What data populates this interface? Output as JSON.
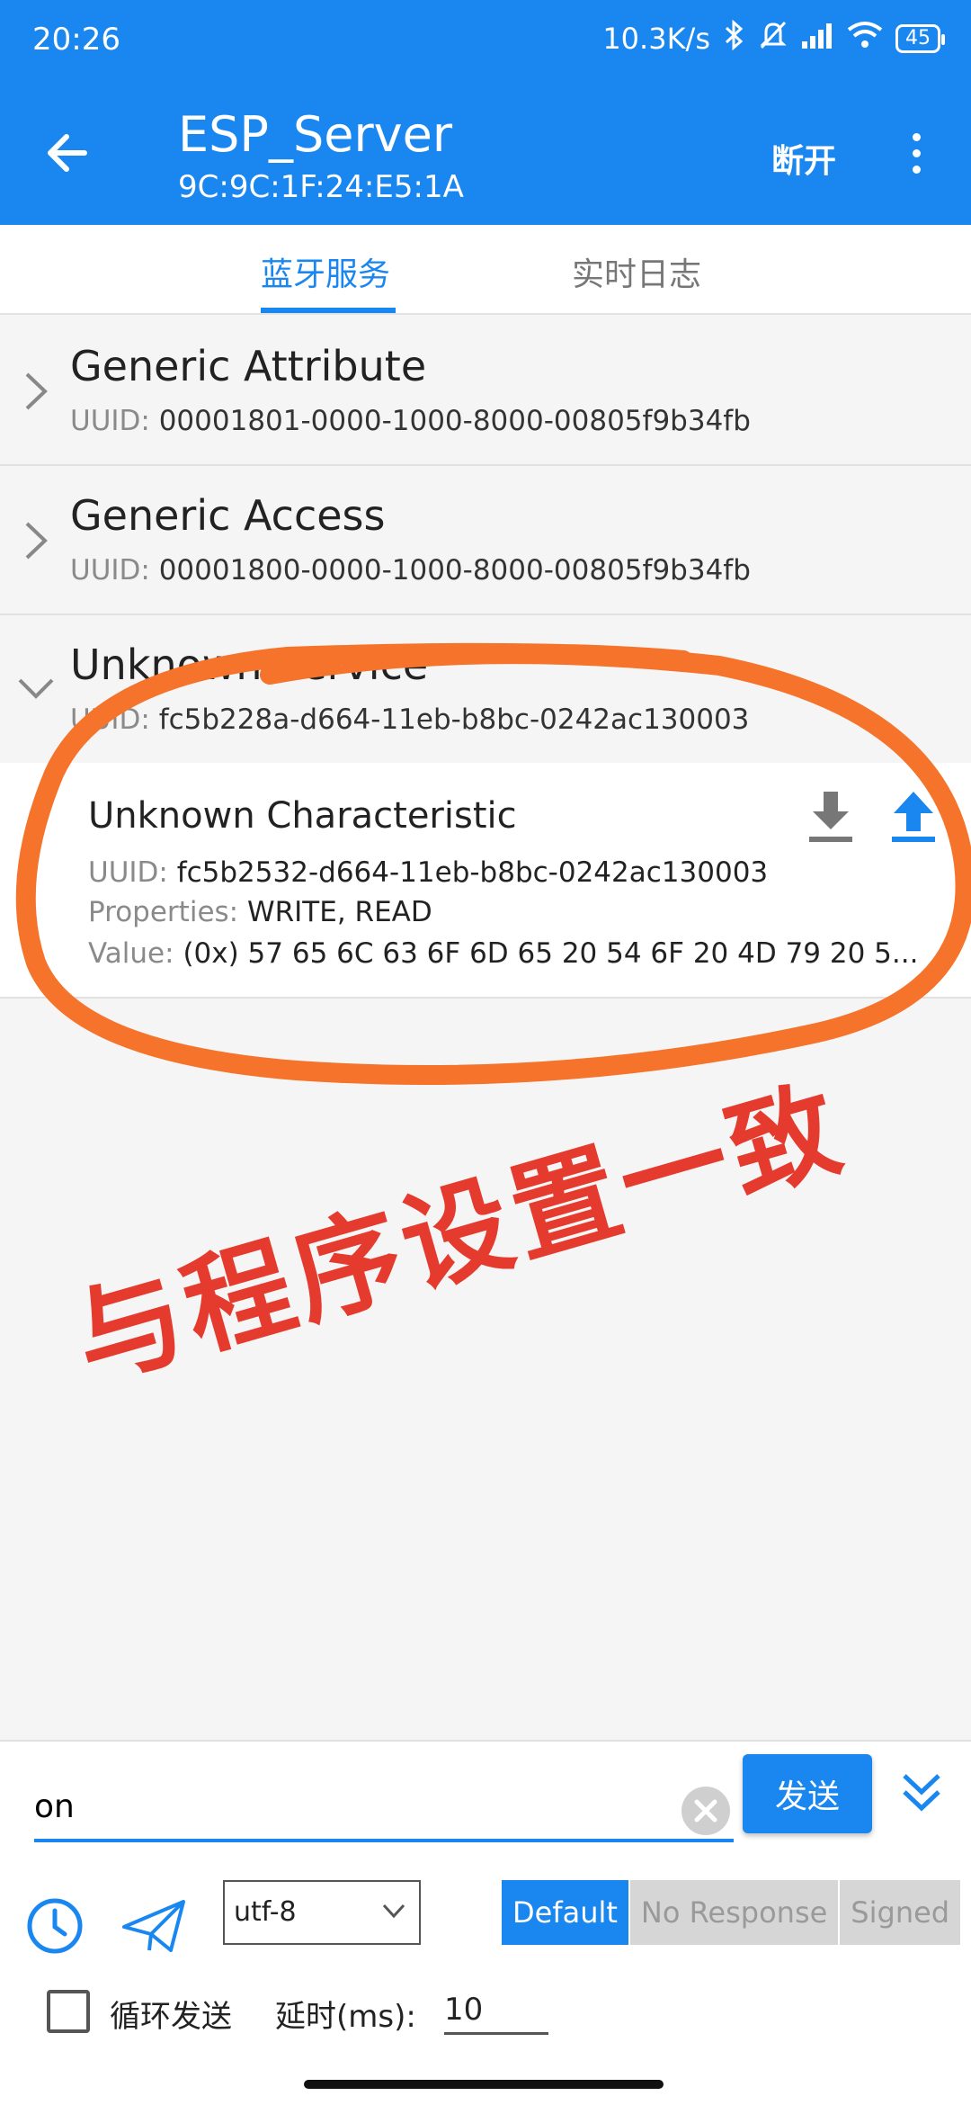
{
  "status": {
    "time": "20:26",
    "net_speed": "10.3K/s",
    "battery": "45"
  },
  "header": {
    "title": "ESP_Server",
    "subtitle": "9C:9C:1F:24:E5:1A",
    "disconnect_label": "断开"
  },
  "tabs": [
    "蓝牙服务",
    "实时日志"
  ],
  "services": [
    {
      "name": "Generic Attribute",
      "uuid_label": "UUID:",
      "uuid": "00001801-0000-1000-8000-00805f9b34fb",
      "expanded": false
    },
    {
      "name": "Generic Access",
      "uuid_label": "UUID:",
      "uuid": "00001800-0000-1000-8000-00805f9b34fb",
      "expanded": false
    },
    {
      "name": "Unknown Service",
      "uuid_label": "UUID:",
      "uuid": "fc5b228a-d664-11eb-b8bc-0242ac130003",
      "expanded": true
    }
  ],
  "characteristic": {
    "name": "Unknown Characteristic",
    "uuid_label": "UUID:",
    "uuid": "fc5b2532-d664-11eb-b8bc-0242ac130003",
    "properties_label": "Properties:",
    "properties": "WRITE, READ",
    "value_label": "Value:",
    "value": "(0x) 57 65 6C 63 6F 6D 65 20 54 6F 20 4D 79 20 5..."
  },
  "annotation": {
    "text": "与程序设置一致",
    "color": "#e53b2e",
    "ring_color": "#f5732a"
  },
  "composer": {
    "input_value": "on",
    "send_label": "发送",
    "encoding": "utf-8",
    "write_modes": [
      "Default",
      "No Response",
      "Signed"
    ],
    "active_mode": "Default",
    "loop_label": "循环发送",
    "delay_label": "延时(ms):",
    "delay_value": "10",
    "loop_checked": false
  },
  "colors": {
    "accent": "#1a87f0"
  }
}
